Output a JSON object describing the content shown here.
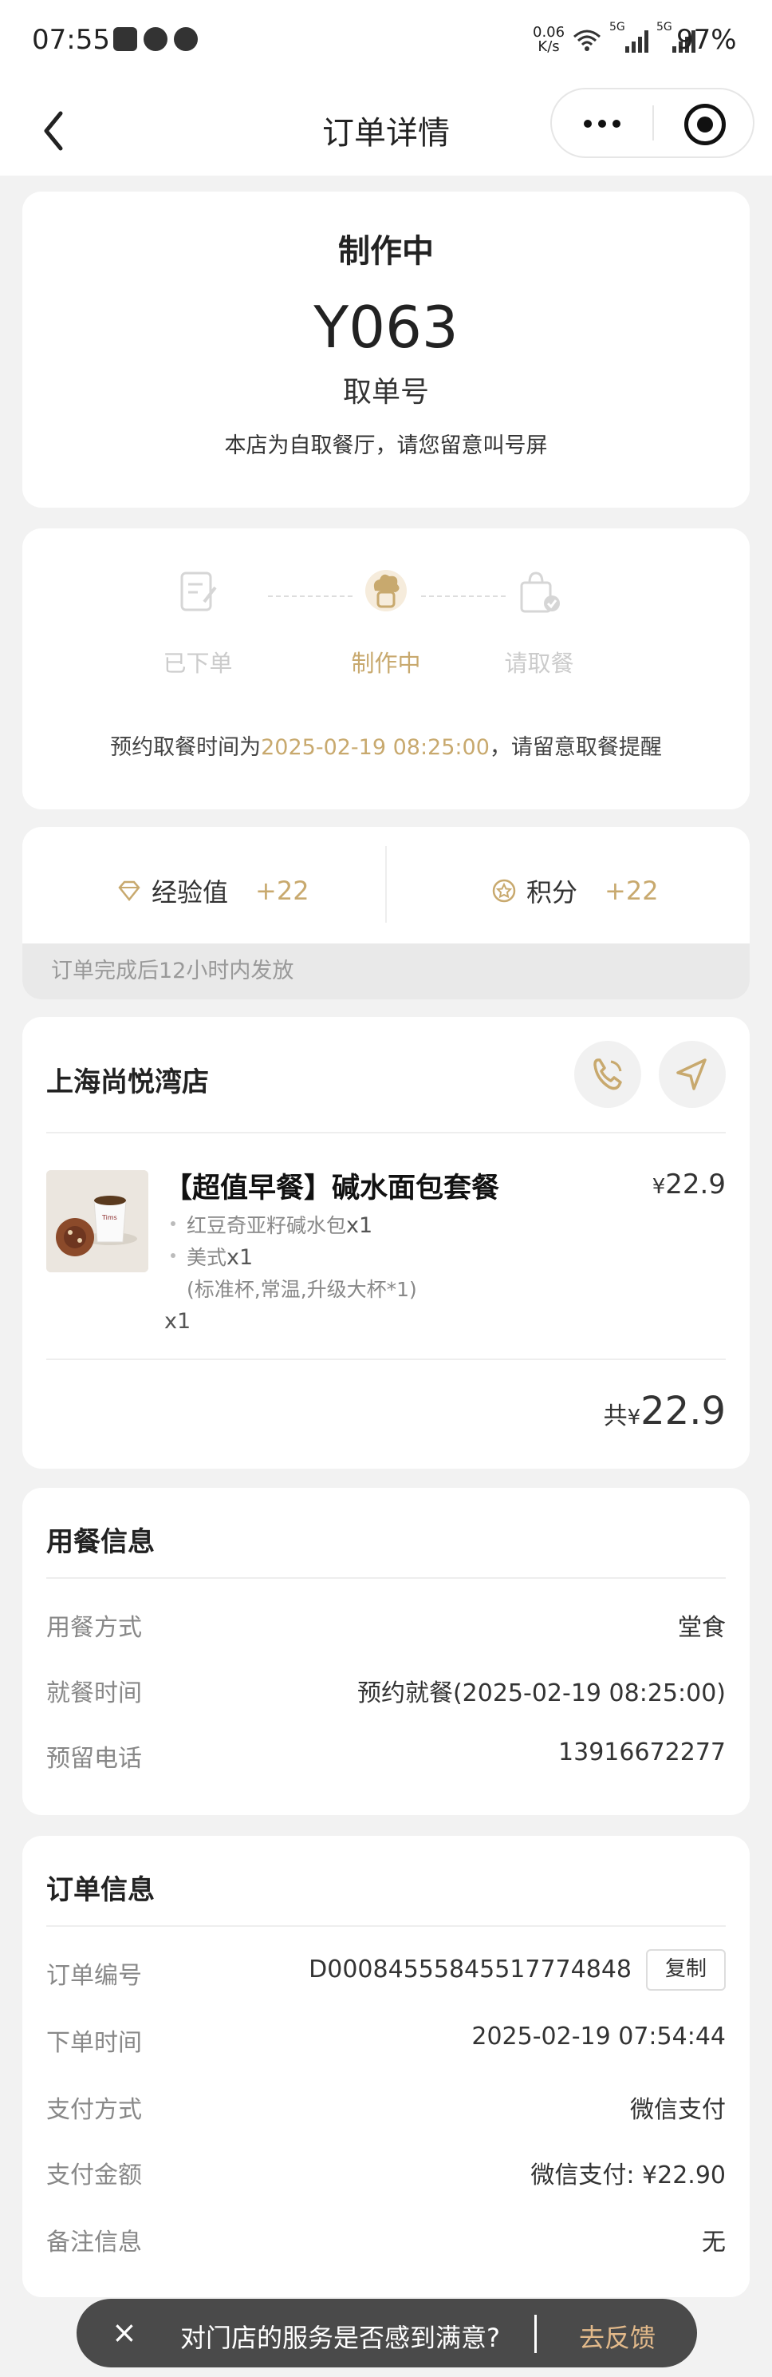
{
  "status_bar": {
    "time": "07:55",
    "net_speed_value": "0.06",
    "net_speed_unit": "K/s",
    "sig1_label": "5G",
    "sig2_label": "5G",
    "battery": "97%"
  },
  "nav": {
    "title": "订单详情"
  },
  "order_status": {
    "state": "制作中",
    "code": "Y063",
    "code_label": "取单号",
    "note": "本店为自取餐厅，请您留意叫号屏"
  },
  "progress": {
    "steps": [
      {
        "label": "已下单",
        "active": false
      },
      {
        "label": "制作中",
        "active": true
      },
      {
        "label": "请取餐",
        "active": false
      }
    ],
    "pickup_prefix": "预约取餐时间为",
    "pickup_time": "2025-02-19 08:25:00",
    "pickup_suffix": "，请留意取餐提醒"
  },
  "rewards": {
    "exp_label": "经验值",
    "exp_value": "+22",
    "points_label": "积分",
    "points_value": "+22",
    "tip": "订单完成后12小时内发放"
  },
  "store": {
    "name": "上海尚悦湾店",
    "product": {
      "name": "【超值早餐】碱水面包套餐",
      "currency": "¥",
      "price": "22.9",
      "items": [
        {
          "name": "红豆奇亚籽碱水包",
          "qty": "x1"
        },
        {
          "name": "美式",
          "qty": "x1"
        }
      ],
      "spec": "(标准杯,常温,升级大杯*1)",
      "qty": "x1",
      "cup_text": "Tims"
    },
    "total_label": "共",
    "total_currency": "¥",
    "total": "22.9"
  },
  "dining": {
    "title": "用餐信息",
    "rows": [
      {
        "label": "用餐方式",
        "value": "堂食"
      },
      {
        "label": "就餐时间",
        "value": "预约就餐(2025-02-19 08:25:00)"
      },
      {
        "label": "预留电话",
        "value": "13916672277"
      }
    ]
  },
  "order_info": {
    "title": "订单信息",
    "copy_label": "复制",
    "rows": [
      {
        "label": "订单编号",
        "value": "D000845558455177748​48"
      },
      {
        "label": "下单时间",
        "value": "2025-02-19 07:54:44"
      },
      {
        "label": "支付方式",
        "value": "微信支付"
      },
      {
        "label": "支付金额",
        "value": "微信支付: ¥22.90"
      },
      {
        "label": "备注信息",
        "value": "无"
      }
    ]
  },
  "toast": {
    "close": "×",
    "question": "对门店的服务是否感到满意?",
    "feedback": "去反馈"
  },
  "colors": {
    "accent": "#c8a96e",
    "background": "#f2f2f2"
  }
}
